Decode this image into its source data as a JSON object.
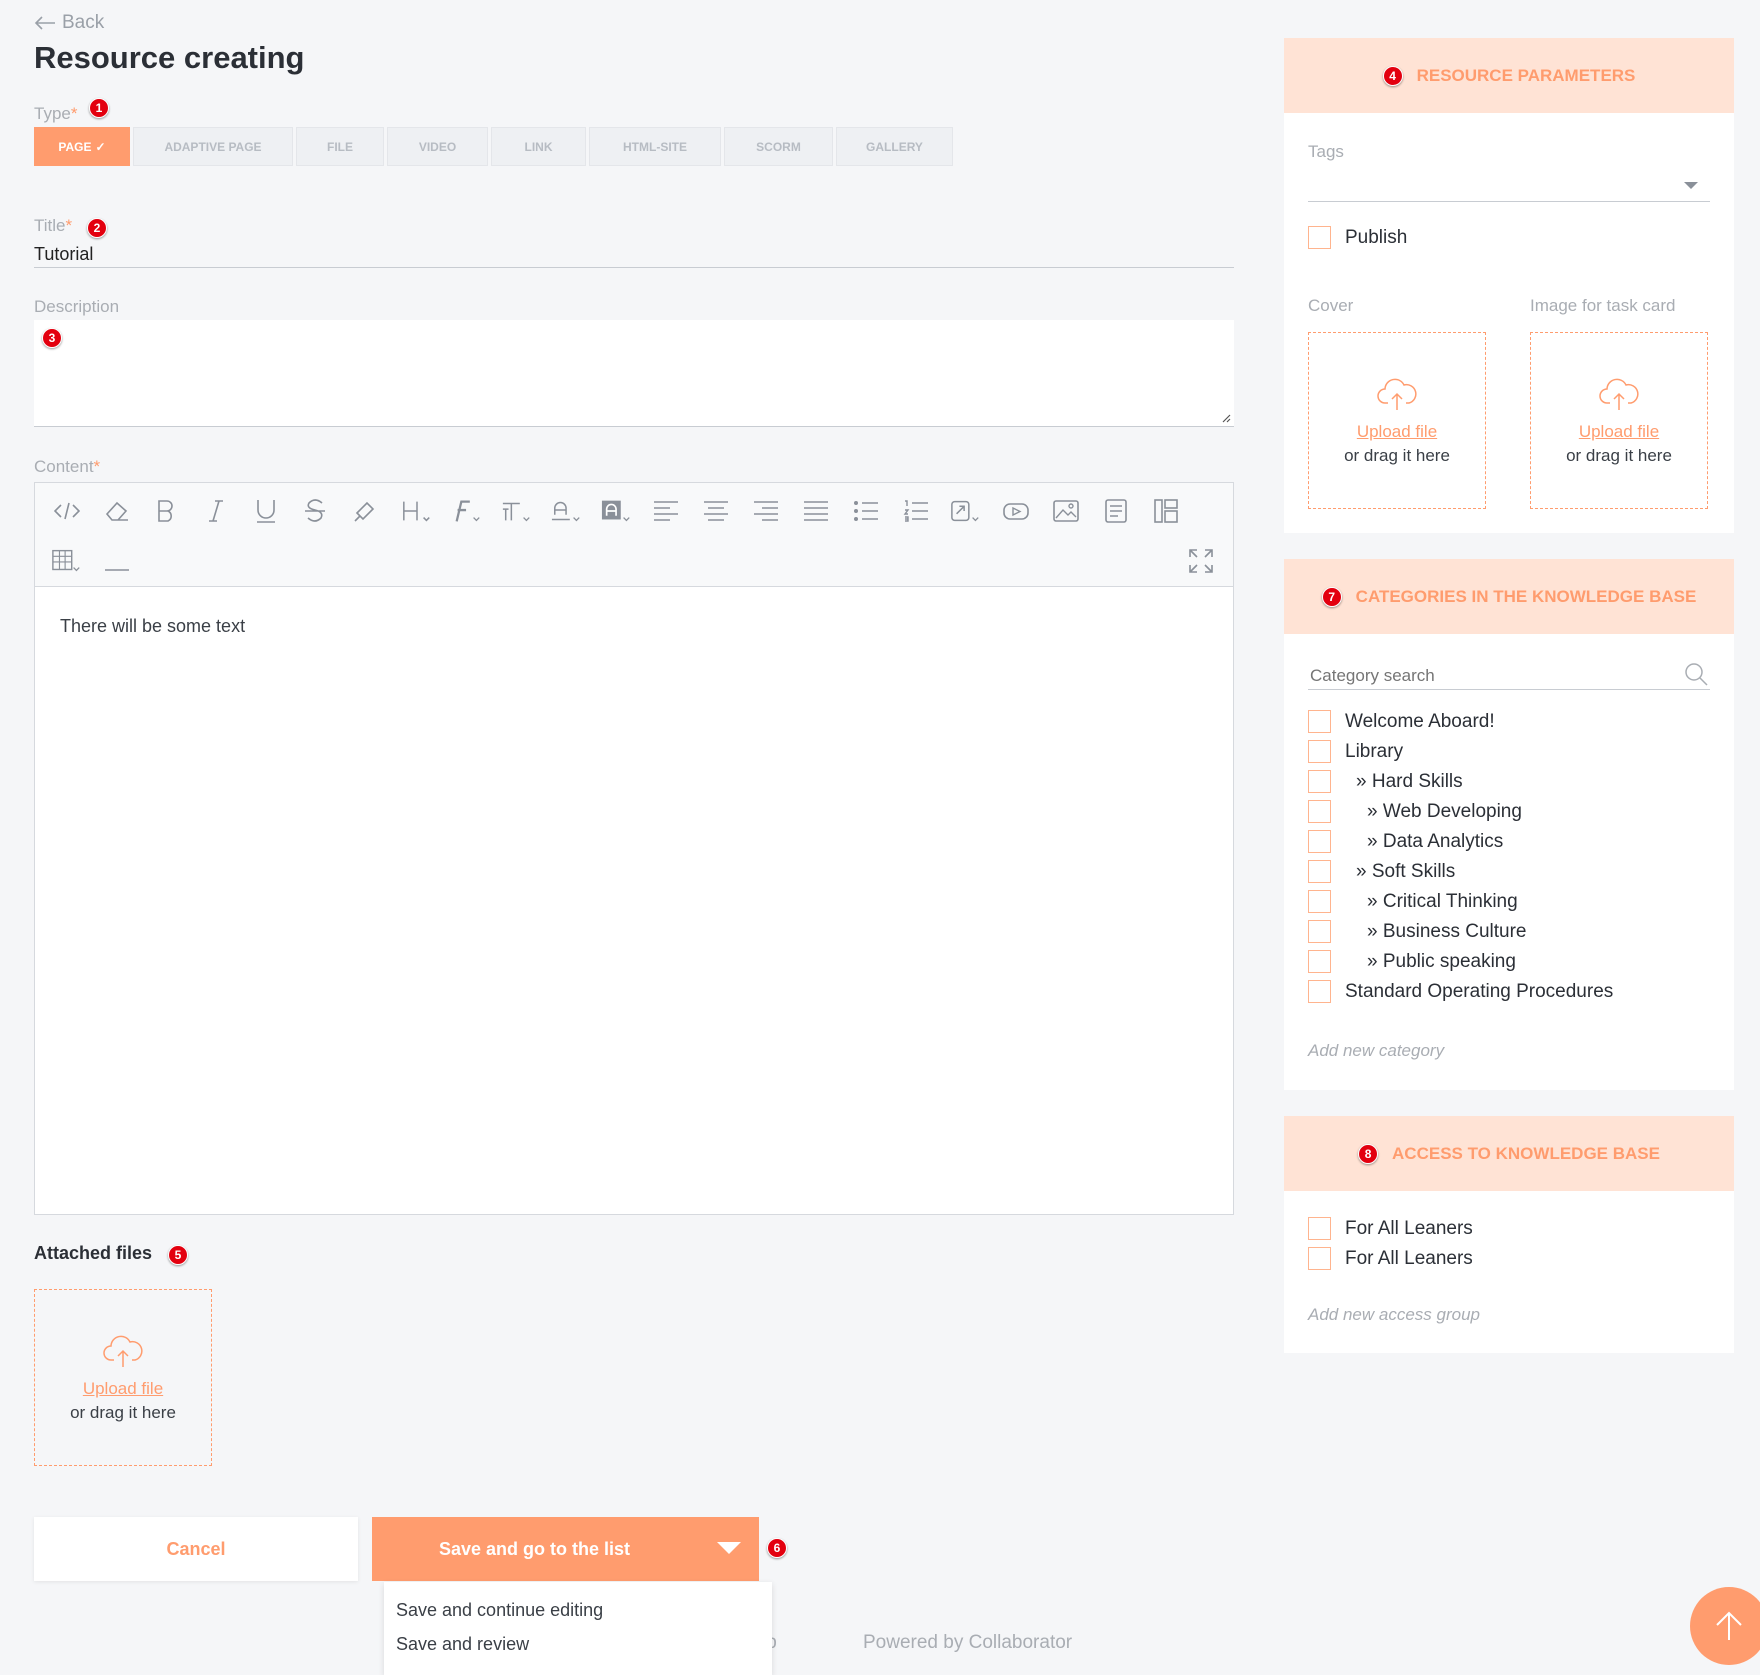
{
  "header": {
    "back_label": "Back",
    "page_title": "Resource creating"
  },
  "form": {
    "type_label": "Type",
    "required_mark": "*",
    "types": [
      "PAGE",
      "ADAPTIVE PAGE",
      "FILE",
      "VIDEO",
      "LINK",
      "HTML-SITE",
      "SCORM",
      "GALLERY"
    ],
    "selected_type": "PAGE",
    "title_label": "Title",
    "title_value": "Tutorial",
    "description_label": "Description",
    "description_value": "",
    "content_label": "Content",
    "content_text": "There will be some text",
    "attached_files_label": "Attached files"
  },
  "upload": {
    "link": "Upload file",
    "sub": "or drag it here"
  },
  "actions": {
    "cancel_label": "Cancel",
    "save_label": "Save and go to the list",
    "dropdown_items": [
      "Save and continue editing",
      "Save and review"
    ]
  },
  "footer": {
    "partial_text": "lp",
    "powered_by": "Powered by Collaborator"
  },
  "resource_parameters": {
    "title": "RESOURCE PARAMETERS",
    "tags_label": "Tags",
    "publish_label": "Publish",
    "cover_label": "Cover",
    "task_card_label": "Image for task card"
  },
  "categories": {
    "title": "CATEGORIES IN THE KNOWLEDGE BASE",
    "search_placeholder": "Category search",
    "items": [
      {
        "label": "Welcome Aboard!",
        "prefix": "",
        "level": 0
      },
      {
        "label": "Library",
        "prefix": "",
        "level": 0
      },
      {
        "label": "Hard Skills",
        "prefix": "» ",
        "level": 1
      },
      {
        "label": "Web Developing",
        "prefix": "» ",
        "level": 2
      },
      {
        "label": "Data Analytics",
        "prefix": "» ",
        "level": 2
      },
      {
        "label": "Soft Skills",
        "prefix": "» ",
        "level": 1
      },
      {
        "label": "Critical Thinking",
        "prefix": "» ",
        "level": 2
      },
      {
        "label": "Business Culture",
        "prefix": "» ",
        "level": 2
      },
      {
        "label": "Public speaking",
        "prefix": "» ",
        "level": 2
      },
      {
        "label": "Standard Operating Procedures",
        "prefix": "",
        "level": 0
      }
    ],
    "add_label": "Add new category"
  },
  "access": {
    "title": "ACCESS TO KNOWLEDGE BASE",
    "items": [
      "For All Leaners",
      "For All Leaners"
    ],
    "add_label": "Add new access group"
  },
  "annotations": [
    "1",
    "2",
    "3",
    "4",
    "5",
    "6",
    "7",
    "8"
  ],
  "colors": {
    "accent": "#ff9c6e",
    "accent_light": "#ffe3d5",
    "badge": "#e3000f",
    "background": "#f5f6f8"
  },
  "icons": [
    "arrow-left-icon",
    "code-icon",
    "eraser-icon",
    "bold-icon",
    "italic-icon",
    "underline-icon",
    "strikethrough-icon",
    "paint-format-icon",
    "heading-icon",
    "font-family-icon",
    "font-size-icon",
    "text-color-icon",
    "background-color-icon",
    "align-left-icon",
    "align-center-icon",
    "align-right-icon",
    "align-justify-icon",
    "bullet-list-icon",
    "numbered-list-icon",
    "link-icon",
    "video-icon",
    "image-icon",
    "file-icon",
    "template-icon",
    "table-icon",
    "horizontal-rule-icon",
    "fullscreen-icon",
    "cloud-upload-icon",
    "chevron-down-icon",
    "search-icon",
    "arrow-up-icon"
  ]
}
